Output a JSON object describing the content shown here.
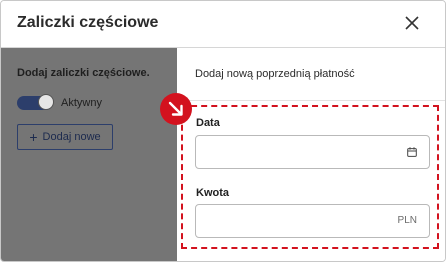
{
  "dialog": {
    "title": "Zaliczki częściowe",
    "close_icon": "close-icon"
  },
  "left": {
    "subtitle": "Dodaj zaliczki częściowe.",
    "toggle_label": "Aktywny",
    "toggle_on": true,
    "add_button": "Dodaj nowe"
  },
  "right": {
    "heading": "Dodaj nową poprzednią płatność",
    "date_label": "Data",
    "date_value": "",
    "amount_label": "Kwota",
    "amount_value": "",
    "amount_unit": "PLN"
  },
  "colors": {
    "accent": "#2c3e6b",
    "highlight": "#d3121e"
  }
}
